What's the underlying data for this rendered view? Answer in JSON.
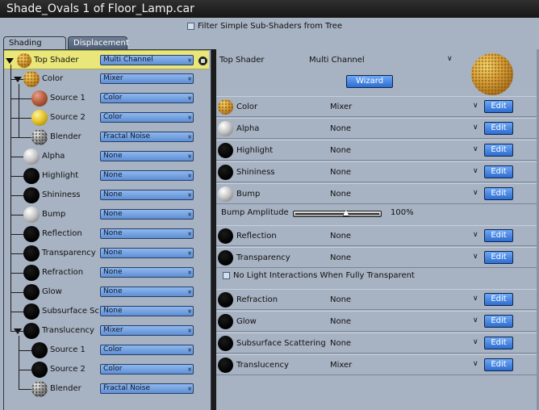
{
  "window": {
    "title": "Shade_Ovals 1 of Floor_Lamp.car"
  },
  "filter": {
    "label": "Filter Simple Sub-Shaders from Tree",
    "checked": false
  },
  "tabs": [
    {
      "label": "Shading",
      "active": true
    },
    {
      "label": "Displacement",
      "active": false
    }
  ],
  "tree": [
    {
      "label": "Top Shader",
      "value": "Multi Channel",
      "ball": "goldtex",
      "depth": 0,
      "expanded": true,
      "highlighted": true
    },
    {
      "label": "Color",
      "value": "Mixer",
      "ball": "goldtex",
      "depth": 1,
      "expanded": true
    },
    {
      "label": "Source 1",
      "value": "Color",
      "ball": "terra",
      "depth": 2
    },
    {
      "label": "Source 2",
      "value": "Color",
      "ball": "yellow",
      "depth": 2
    },
    {
      "label": "Blender",
      "value": "Fractal Noise",
      "ball": "noise",
      "depth": 2
    },
    {
      "label": "Alpha",
      "value": "None",
      "ball": "white",
      "depth": 1
    },
    {
      "label": "Highlight",
      "value": "None",
      "ball": "black",
      "depth": 1
    },
    {
      "label": "Shininess",
      "value": "None",
      "ball": "black",
      "depth": 1
    },
    {
      "label": "Bump",
      "value": "None",
      "ball": "white",
      "depth": 1
    },
    {
      "label": "Reflection",
      "value": "None",
      "ball": "black",
      "depth": 1
    },
    {
      "label": "Transparency",
      "value": "None",
      "ball": "black",
      "depth": 1
    },
    {
      "label": "Refraction",
      "value": "None",
      "ball": "black",
      "depth": 1
    },
    {
      "label": "Glow",
      "value": "None",
      "ball": "black",
      "depth": 1
    },
    {
      "label": "Subsurface Sc",
      "value": "None",
      "ball": "black",
      "depth": 1
    },
    {
      "label": "Translucency",
      "value": "Mixer",
      "ball": "black",
      "depth": 1,
      "expanded": true
    },
    {
      "label": "Source 1",
      "value": "Color",
      "ball": "black",
      "depth": 2
    },
    {
      "label": "Source 2",
      "value": "Color",
      "ball": "black",
      "depth": 2
    },
    {
      "label": "Blender",
      "value": "Fractal Noise",
      "ball": "noise",
      "depth": 2
    }
  ],
  "right": {
    "top_label": "Top Shader",
    "top_value": "Multi Channel",
    "wizard_label": "Wizard",
    "edit_label": "Edit",
    "bump_amplitude_label": "Bump Amplitude",
    "bump_amplitude_value": "100%",
    "bump_amplitude_fraction": 0.6,
    "no_light_label": "No Light Interactions When Fully Transparent",
    "no_light_checked": false,
    "channels": [
      {
        "label": "Color",
        "value": "Mixer",
        "ball": "goldtex"
      },
      {
        "label": "Alpha",
        "value": "None",
        "ball": "white"
      },
      {
        "label": "Highlight",
        "value": "None",
        "ball": "black"
      },
      {
        "label": "Shininess",
        "value": "None",
        "ball": "black"
      },
      {
        "label": "Bump",
        "value": "None",
        "ball": "white"
      },
      {
        "label": "Reflection",
        "value": "None",
        "ball": "black"
      },
      {
        "label": "Transparency",
        "value": "None",
        "ball": "black"
      },
      {
        "label": "Refraction",
        "value": "None",
        "ball": "black"
      },
      {
        "label": "Glow",
        "value": "None",
        "ball": "black"
      },
      {
        "label": "Subsurface Scattering",
        "value": "None",
        "ball": "black"
      },
      {
        "label": "Translucency",
        "value": "Mixer",
        "ball": "black"
      }
    ]
  }
}
